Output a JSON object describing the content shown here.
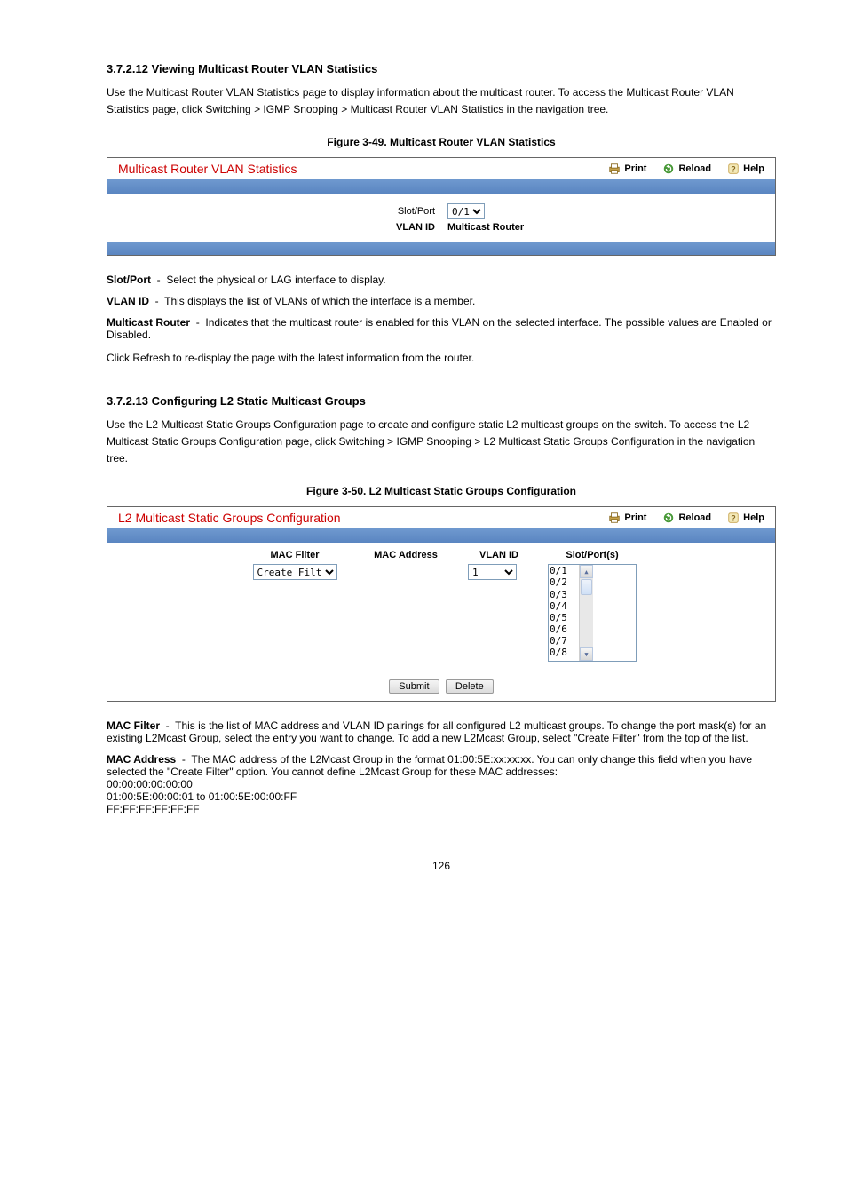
{
  "sections": {
    "s1": {
      "heading": "3.7.2.12 Viewing Multicast Router VLAN Statistics",
      "text": "Use the Multicast Router VLAN Statistics page to display information about the multicast router. To access the Multicast Router VLAN Statistics page, click Switching > IGMP Snooping > Multicast Router VLAN Statistics in the navigation tree."
    },
    "figCaption1": "Figure 3-49. Multicast Router VLAN Statistics",
    "panel1": {
      "title": "Multicast Router VLAN Statistics",
      "actions": {
        "print": "Print",
        "reload": "Reload",
        "help": "Help"
      },
      "slotPortLabel": "Slot/Port",
      "slotPortValue": "0/1",
      "vlanIdLabel": "VLAN ID",
      "multicastRouterLabel": "Multicast Router"
    },
    "fields1": [
      {
        "name": "Slot/Port",
        "desc": "Select the physical or LAG interface to display."
      },
      {
        "name": "VLAN ID",
        "desc": "This displays the list of VLANs of which the interface is a member."
      },
      {
        "name": "Multicast Router",
        "desc": "Indicates that the multicast router is enabled for this VLAN on the selected interface. The possible values are Enabled or Disabled."
      }
    ],
    "s2refresh": "Click Refresh to re-display the page with the latest information from the router.",
    "s2": {
      "heading": "3.7.2.13 Configuring L2 Static Multicast Groups",
      "text": "Use the L2 Multicast Static Groups Configuration page to create and configure static L2 multicast groups on the switch. To access the L2 Multicast Static Groups Configuration page, click Switching > IGMP Snooping > L2 Multicast Static Groups Configuration in the navigation tree."
    },
    "figCaption2": "Figure 3-50. L2 Multicast Static Groups Configuration",
    "panel2": {
      "title": "L2 Multicast Static Groups Configuration",
      "actions": {
        "print": "Print",
        "reload": "Reload",
        "help": "Help"
      },
      "headers": {
        "macFilter": "MAC Filter",
        "macAddress": "MAC Address",
        "vlanId": "VLAN ID",
        "slotPorts": "Slot/Port(s)"
      },
      "macFilterValue": "Create Filter",
      "vlanIdValue": "1",
      "portList": [
        "0/1",
        "0/2",
        "0/3",
        "0/4",
        "0/5",
        "0/6",
        "0/7",
        "0/8"
      ],
      "submit": "Submit",
      "delete": "Delete"
    },
    "fields2": [
      {
        "name": "MAC Filter",
        "desc": "This is the list of MAC address and VLAN ID pairings for all configured L2 multicast groups. To change the port mask(s) for an existing L2Mcast Group, select the entry you want to change. To add a new L2Mcast Group, select \"Create Filter\" from the top of the list."
      },
      {
        "name": "MAC Address",
        "desc": "The MAC address of the L2Mcast Group in the format 01:00:5E:xx:xx:xx. You can only change this field when you have selected the \"Create Filter\" option. You cannot define L2Mcast Group for these MAC addresses:\n00:00:00:00:00:00\n01:00:5E:00:00:01 to 01:00:5E:00:00:FF\nFF:FF:FF:FF:FF:FF"
      }
    ],
    "pageNum": "126"
  }
}
